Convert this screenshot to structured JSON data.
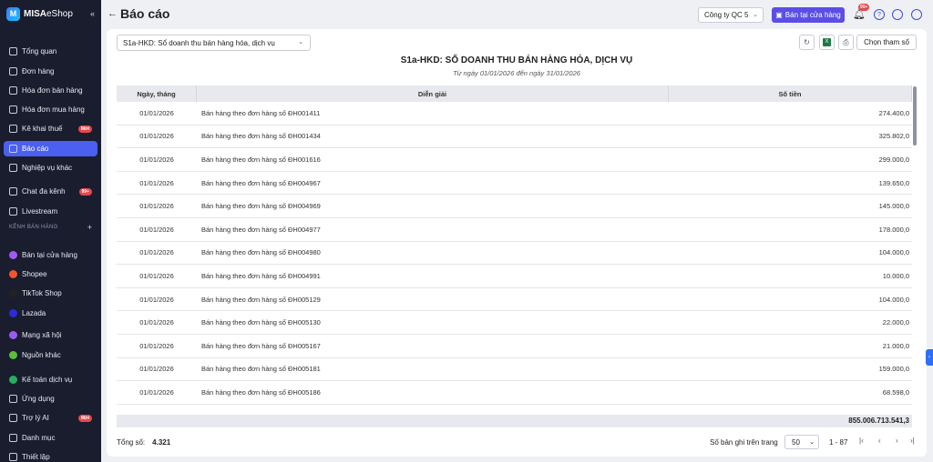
{
  "app": {
    "logo_mark": "M",
    "logo_text_bold": "MISA",
    "logo_text_rest": "eShop",
    "collapse_icon": "«"
  },
  "sidebar": {
    "items": [
      {
        "label": "Tổng quan",
        "top": 0
      },
      {
        "label": "Đơn hàng"
      },
      {
        "label": "Hóa đơn bán hàng"
      },
      {
        "label": "Hóa đơn mua hàng"
      },
      {
        "label": "Kê khai thuế",
        "badge": "Mới"
      },
      {
        "label": "Báo cáo",
        "active": true
      },
      {
        "label": "Nghiệp vụ khác"
      },
      {
        "label": "Chat đa kênh",
        "badge": "99+"
      },
      {
        "label": "Livestream"
      }
    ],
    "section_label": "KÊNH BÁN HÀNG",
    "channels": [
      {
        "label": "Bán tại cửa hàng",
        "color": "#a259f7"
      },
      {
        "label": "Shopee",
        "color": "#f2552c"
      },
      {
        "label": "TikTok Shop",
        "color": "#222222"
      },
      {
        "label": "Lazada",
        "color": "#2c2cdb"
      }
    ],
    "extras": [
      {
        "label": "Mạng xã hội",
        "color": "#9b59f7"
      },
      {
        "label": "Nguồn khác",
        "color": "#5bbf3a"
      },
      {
        "label": "Kế toán dịch vụ",
        "color": "#27ae60"
      },
      {
        "label": "Ứng dụng"
      },
      {
        "label": "Trợ lý AI",
        "badge": "Mới"
      },
      {
        "label": "Danh mục"
      },
      {
        "label": "Thiết lập"
      }
    ]
  },
  "topbar": {
    "title": "Báo cáo",
    "company": "Công ty QC 5",
    "store_button": "Bán tại cửa hàng",
    "notif_badge": "99+"
  },
  "report": {
    "selector": "S1a-HKD: Sổ doanh thu bán hàng hóa, dịch vụ",
    "choose_params": "Chọn tham số",
    "title": "S1a-HKD: SỔ DOANH THU BÁN HÀNG HÓA, DỊCH VỤ",
    "subtitle": "Từ ngày 01/01/2026 đến ngày 31/01/2026",
    "columns": [
      "Ngày, tháng",
      "Diễn giải",
      "Số tiền"
    ],
    "rows": [
      [
        "01/01/2026",
        "Bán hàng theo đơn hàng số ĐH001411",
        "274.400,0"
      ],
      [
        "01/01/2026",
        "Bán hàng theo đơn hàng số ĐH001434",
        "325.802,0"
      ],
      [
        "01/01/2026",
        "Bán hàng theo đơn hàng số ĐH001616",
        "299.000,0"
      ],
      [
        "01/01/2026",
        "Bán hàng theo đơn hàng số ĐH004967",
        "139.650,0"
      ],
      [
        "01/01/2026",
        "Bán hàng theo đơn hàng số ĐH004969",
        "145.000,0"
      ],
      [
        "01/01/2026",
        "Bán hàng theo đơn hàng số ĐH004977",
        "178.000,0"
      ],
      [
        "01/01/2026",
        "Bán hàng theo đơn hàng số ĐH004980",
        "104.000,0"
      ],
      [
        "01/01/2026",
        "Bán hàng theo đơn hàng số ĐH004991",
        "10.000,0"
      ],
      [
        "01/01/2026",
        "Bán hàng theo đơn hàng số ĐH005129",
        "104.000,0"
      ],
      [
        "01/01/2026",
        "Bán hàng theo đơn hàng số ĐH005130",
        "22.000,0"
      ],
      [
        "01/01/2026",
        "Bán hàng theo đơn hàng số ĐH005167",
        "21.000,0"
      ],
      [
        "01/01/2026",
        "Bán hàng theo đơn hàng số ĐH005181",
        "159.000,0"
      ],
      [
        "01/01/2026",
        "Bán hàng theo đơn hàng số ĐH005186",
        "68.598,0"
      ]
    ],
    "grand_total": "855.006.713.541,3"
  },
  "footer": {
    "total_label": "Tổng số:",
    "total_value": "4.321",
    "per_page_label": "Số bản ghi trên trang",
    "per_page_value": "50",
    "range": "1 - 87"
  }
}
